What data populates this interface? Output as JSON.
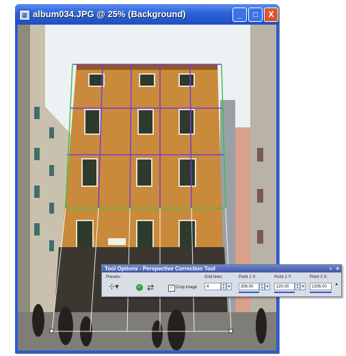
{
  "window": {
    "title": "album034.JPG @  25% (Background)",
    "minimize_glyph": "_",
    "maximize_glyph": "□",
    "close_glyph": "X"
  },
  "tool_options": {
    "title": "Tool Options - Perspective Correction Tool",
    "presets_label": "Presets:",
    "crop_image_label": "Crop image",
    "crop_image_checked": true,
    "grid_lines_label": "Grid lines:",
    "grid_lines_value": "4",
    "point1x_label": "Point 1 X:",
    "point1x_value": "306.00",
    "point1y_label": "Point 1 Y:",
    "point1y_value": "220.00",
    "point2x_label": "Point 2 X:",
    "point2x_value": "1206.00"
  },
  "icons": {
    "app": "image-icon",
    "presets": "preset-icon",
    "apply": "apply-check-icon",
    "reset": "reset-icon",
    "more": "more-arrow-icon"
  },
  "colors": {
    "titlebar": "#2d62d8",
    "close_button": "#d9572e",
    "grid_line": "#7a3ad8",
    "grid_edge": "#3ac24a"
  }
}
